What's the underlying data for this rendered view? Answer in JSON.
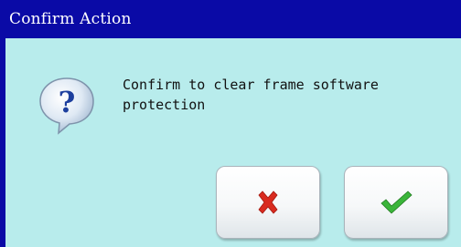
{
  "dialog": {
    "title": "Confirm Action",
    "message": "Confirm to clear frame software protection",
    "icon": "question-icon"
  },
  "buttons": {
    "cancel_icon": "close-icon",
    "confirm_icon": "checkmark-icon"
  },
  "colors": {
    "title_bar": "#0a0aa6",
    "body_background": "#b8ecec",
    "cancel_red": "#d92b1f",
    "confirm_green": "#3bb53a"
  }
}
